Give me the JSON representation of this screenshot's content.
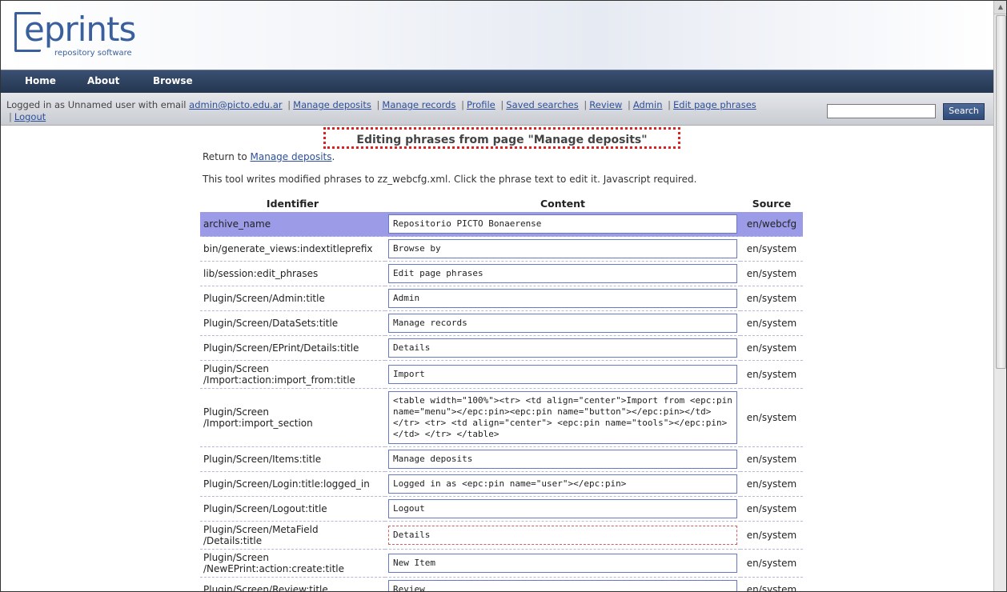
{
  "logo": {
    "word": "eprints",
    "sub": "repository software"
  },
  "nav": [
    "Home",
    "About",
    "Browse"
  ],
  "userbar": {
    "prefix": "Logged in as Unnamed user with email",
    "email": "admin@picto.edu.ar",
    "links": [
      "Manage deposits",
      "Manage records",
      "Profile",
      "Saved searches",
      "Review",
      "Admin",
      "Edit page phrases",
      "Logout"
    ]
  },
  "search": {
    "button": "Search",
    "value": ""
  },
  "page": {
    "title": "Editing phrases from page \"Manage deposits\"",
    "return_prefix": "Return to",
    "return_link": "Manage deposits",
    "return_suffix": ".",
    "description": "This tool writes modified phrases to zz_webcfg.xml. Click the phrase text to edit it. Javascript required."
  },
  "table": {
    "headers": [
      "Identifier",
      "Content",
      "Source"
    ],
    "rows": [
      {
        "id": "archive_name",
        "content": "Repositorio PICTO Bonaerense",
        "source": "en/webcfg"
      },
      {
        "id": "bin/generate_views:indextitleprefix",
        "content": "Browse by",
        "source": "en/system"
      },
      {
        "id": "lib/session:edit_phrases",
        "content": "Edit page phrases",
        "source": "en/system"
      },
      {
        "id": "Plugin/Screen/Admin:title",
        "content": "Admin",
        "source": "en/system"
      },
      {
        "id": "Plugin/Screen/DataSets:title",
        "content": "Manage records",
        "source": "en/system"
      },
      {
        "id": "Plugin/Screen/EPrint/Details:title",
        "content": "Details",
        "source": "en/system"
      },
      {
        "id": "Plugin/Screen\n/Import:action:import_from:title",
        "content": "Import",
        "source": "en/system"
      },
      {
        "id": "Plugin/Screen\n/Import:import_section",
        "content": "<table width=\"100%\"><tr> <td align=\"center\">Import from <epc:pin name=\"menu\"></epc:pin><epc:pin name=\"button\"></epc:pin></td> </tr> <tr> <td align=\"center\"> <epc:pin name=\"tools\"></epc:pin> </td> </tr> </table>",
        "source": "en/system"
      },
      {
        "id": "Plugin/Screen/Items:title",
        "content": "Manage deposits",
        "source": "en/system"
      },
      {
        "id": "Plugin/Screen/Login:title:logged_in",
        "content": "Logged in as <epc:pin name=\"user\"></epc:pin>",
        "source": "en/system"
      },
      {
        "id": "Plugin/Screen/Logout:title",
        "content": "Logout",
        "source": "en/system"
      },
      {
        "id": "Plugin/Screen/MetaField\n/Details:title",
        "content": "Details",
        "source": "en/system"
      },
      {
        "id": "Plugin/Screen\n/NewEPrint:action:create:title",
        "content": "New Item",
        "source": "en/system"
      },
      {
        "id": "Plugin/Screen/Review:title",
        "content": "Review",
        "source": "en/system"
      }
    ]
  }
}
